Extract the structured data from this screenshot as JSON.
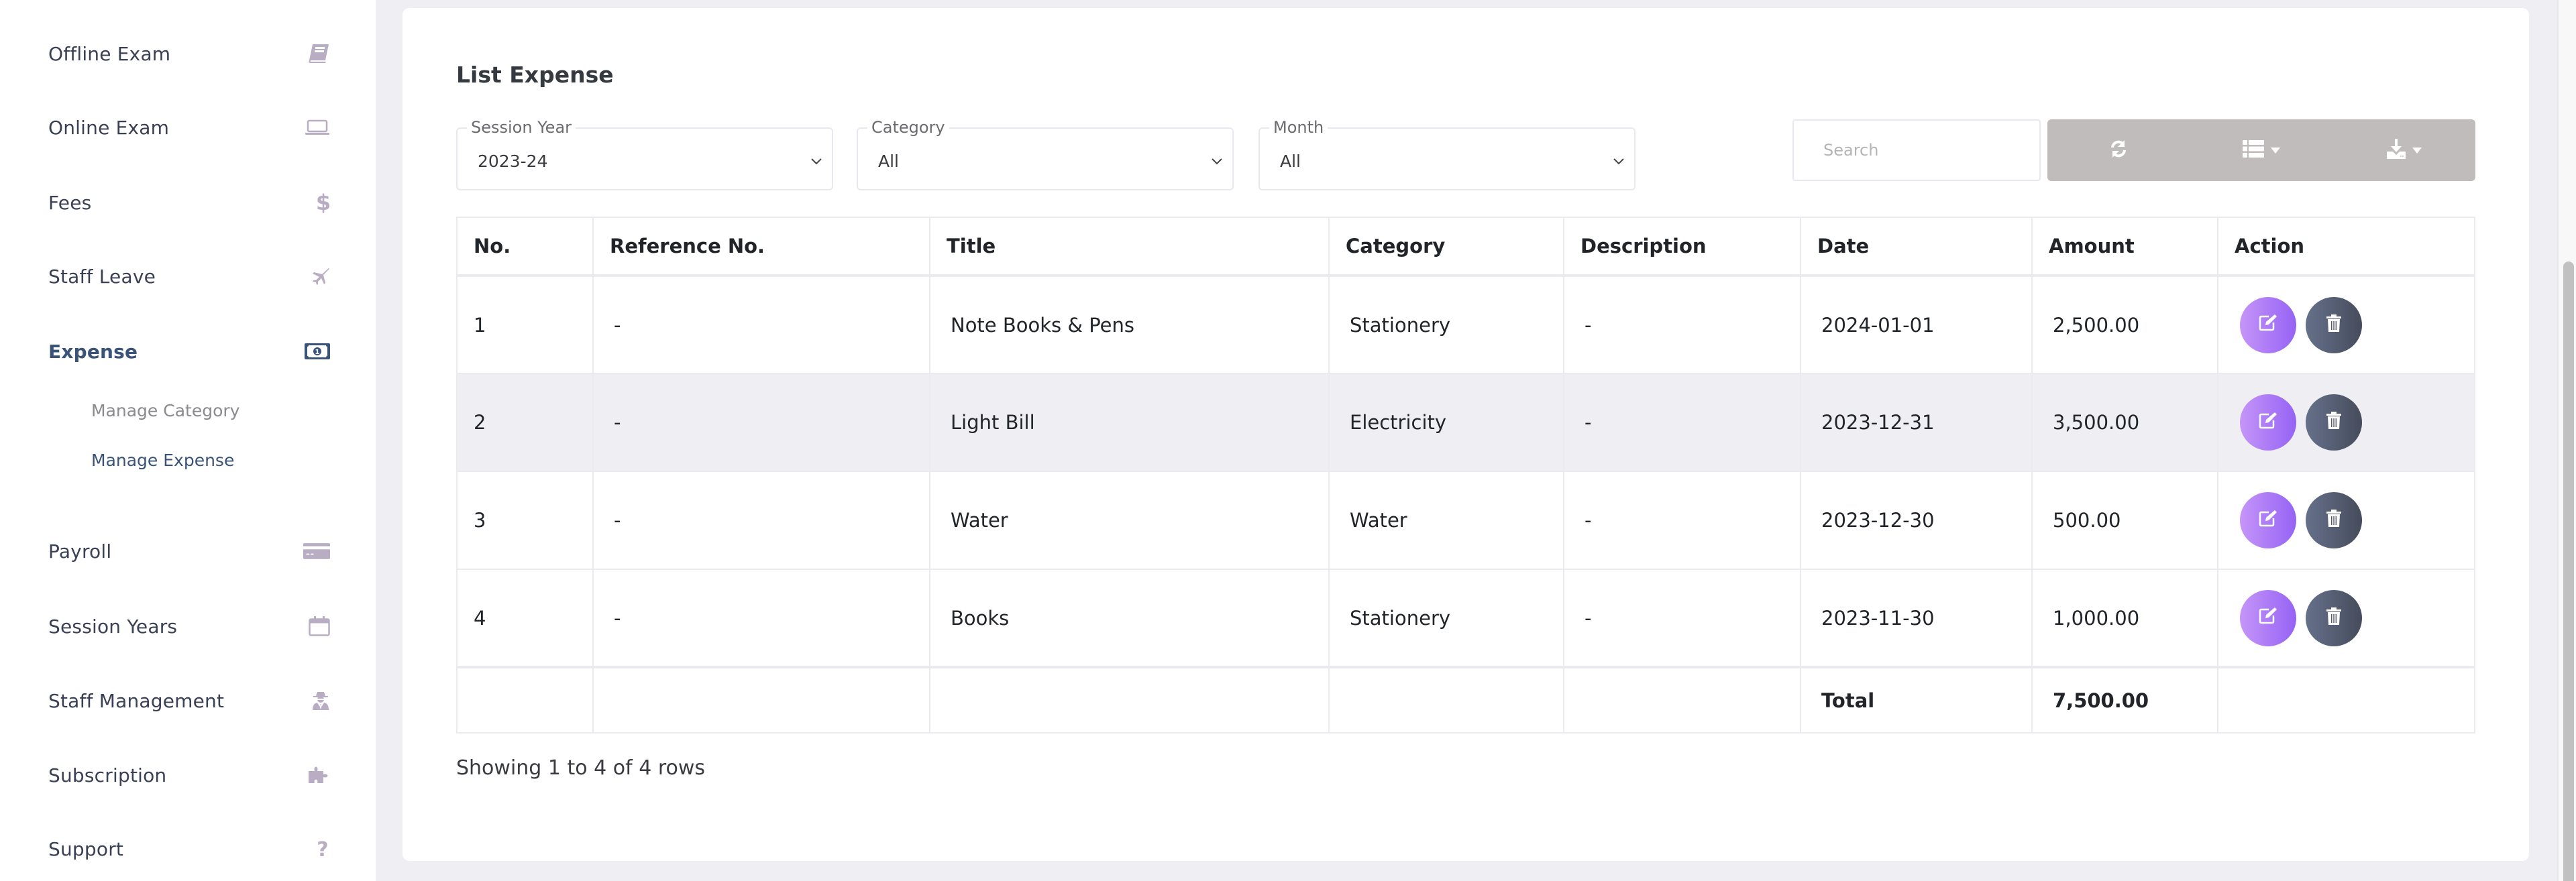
{
  "sidebar": {
    "items": [
      {
        "label": "Offline Exam",
        "icon": "book-icon"
      },
      {
        "label": "Online Exam",
        "icon": "laptop-icon"
      },
      {
        "label": "Fees",
        "icon": "dollar-icon"
      },
      {
        "label": "Staff Leave",
        "icon": "plane-icon"
      },
      {
        "label": "Expense",
        "icon": "money-bill-icon",
        "active": true
      },
      {
        "label": "Payroll",
        "icon": "credit-card-icon"
      },
      {
        "label": "Session Years",
        "icon": "calendar-icon"
      },
      {
        "label": "Staff Management",
        "icon": "user-secret-icon"
      },
      {
        "label": "Subscription",
        "icon": "puzzle-icon"
      },
      {
        "label": "Support",
        "icon": "question-icon"
      }
    ],
    "expense_submenu": [
      {
        "label": "Manage Category",
        "active": false
      },
      {
        "label": "Manage Expense",
        "active": true
      }
    ]
  },
  "card": {
    "title": "List Expense",
    "filters": {
      "session_year": {
        "label": "Session Year",
        "value": "2023-24"
      },
      "category": {
        "label": "Category",
        "value": "All"
      },
      "month": {
        "label": "Month",
        "value": "All"
      }
    },
    "search": {
      "placeholder": "Search",
      "value": ""
    },
    "toolbar": {
      "refresh_icon": "refresh-icon",
      "columns_icon": "list-icon",
      "export_icon": "download-icon"
    }
  },
  "table": {
    "columns": [
      "No.",
      "Reference No.",
      "Title",
      "Category",
      "Description",
      "Date",
      "Amount",
      "Action"
    ],
    "rows": [
      {
        "no": "1",
        "ref": "-",
        "title": "Note Books & Pens",
        "category": "Stationery",
        "description": "-",
        "date": "2024-01-01",
        "amount": "2,500.00"
      },
      {
        "no": "2",
        "ref": "-",
        "title": "Light Bill",
        "category": "Electricity",
        "description": "-",
        "date": "2023-12-31",
        "amount": "3,500.00"
      },
      {
        "no": "3",
        "ref": "-",
        "title": "Water",
        "category": "Water",
        "description": "-",
        "date": "2023-12-30",
        "amount": "500.00"
      },
      {
        "no": "4",
        "ref": "-",
        "title": "Books",
        "category": "Stationery",
        "description": "-",
        "date": "2023-11-30",
        "amount": "1,000.00"
      }
    ],
    "footer": {
      "total_label": "Total",
      "total_value": "7,500.00"
    }
  },
  "pagination": {
    "info": "Showing 1 to 4 of 4 rows"
  },
  "colors": {
    "active_nav": "#3a5479",
    "icon_muted": "#b9adc4",
    "edit_button": "#9563f4",
    "delete_button": "#464c5c",
    "toolbar": "#c0bcbb",
    "stripe": "#efeef3"
  }
}
